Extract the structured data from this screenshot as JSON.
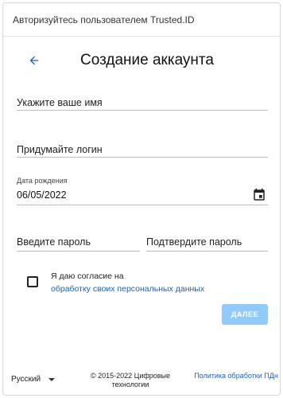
{
  "header": {
    "title": "Авторизуйтесь пользователем Trusted.ID"
  },
  "page": {
    "title": "Создание аккаунта"
  },
  "form": {
    "name_placeholder": "Укажите ваше имя",
    "login_placeholder": "Придумайте логин",
    "dob_label": "Дата рождения",
    "dob_value": "06/05/2022",
    "password_placeholder": "Введите пароль",
    "confirm_placeholder": "Подтвердите пароль"
  },
  "consent": {
    "text": "Я даю согласие на",
    "link": "обработку своих персональных данных",
    "checked": false
  },
  "actions": {
    "next_label": "ДАЛЕЕ"
  },
  "footer": {
    "language": "Русский",
    "copyright": "© 2015-2022 Цифровые технологии",
    "policy_link": "Политика обработки ПДн"
  },
  "colors": {
    "accent": "#1b5fc6",
    "button_disabled": "#90caf9"
  }
}
